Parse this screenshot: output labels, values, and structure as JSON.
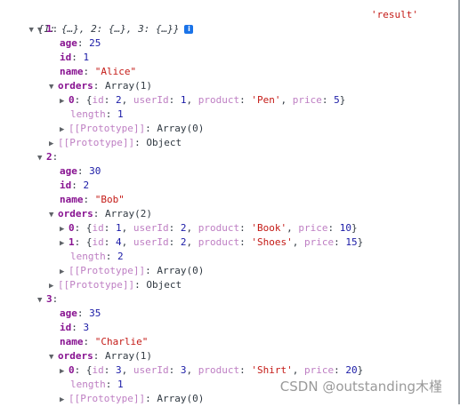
{
  "header": {
    "summary": "{1: {…}, 2: {…}, 3: {…}}",
    "label": "'result'",
    "info_icon": "i"
  },
  "users": [
    {
      "key": "1",
      "age": "25",
      "id": "1",
      "name": "\"Alice\"",
      "orders_summary": "Array(1)",
      "orders": [
        {
          "index": "0",
          "id": "2",
          "userId": "1",
          "product": "'Pen'",
          "price": "5"
        }
      ],
      "length": "1",
      "orders_proto": "Array(0)",
      "user_proto": "Object"
    },
    {
      "key": "2",
      "age": "30",
      "id": "2",
      "name": "\"Bob\"",
      "orders_summary": "Array(2)",
      "orders": [
        {
          "index": "0",
          "id": "1",
          "userId": "2",
          "product": "'Book'",
          "price": "10"
        },
        {
          "index": "1",
          "id": "4",
          "userId": "2",
          "product": "'Shoes'",
          "price": "15"
        }
      ],
      "length": "2",
      "orders_proto": "Array(0)",
      "user_proto": "Object"
    },
    {
      "key": "3",
      "age": "35",
      "id": "3",
      "name": "\"Charlie\"",
      "orders_summary": "Array(1)",
      "orders": [
        {
          "index": "0",
          "id": "3",
          "userId": "3",
          "product": "'Shirt'",
          "price": "20"
        }
      ],
      "length": "1",
      "orders_proto": "Array(0)"
    }
  ],
  "labels": {
    "age": "age",
    "id": "id",
    "name": "name",
    "orders": "orders",
    "length": "length",
    "prototype": "[[Prototype]]",
    "userId": "userId",
    "product": "product",
    "price": "price"
  },
  "watermark": "CSDN @outstanding木槿",
  "colors": {
    "key": "#881391",
    "number": "#1a1aa6",
    "string": "#c41a16",
    "text": "#303942",
    "info": "#1a73e8"
  }
}
